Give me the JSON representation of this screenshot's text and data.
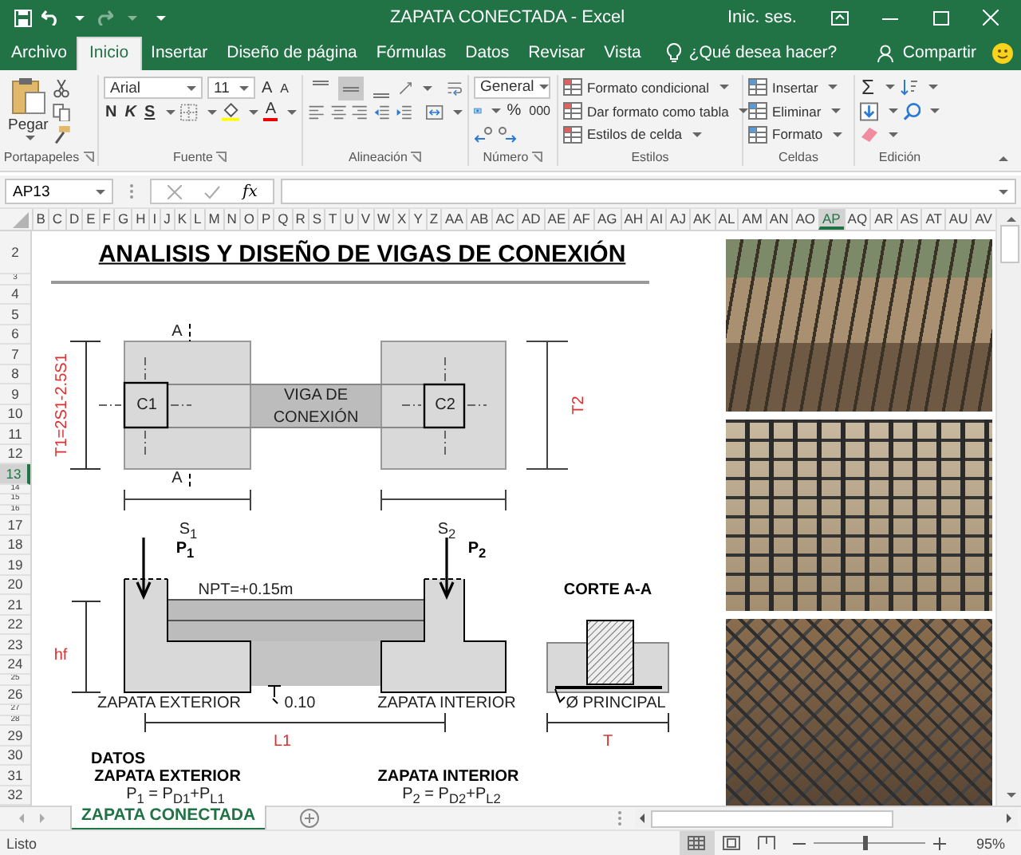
{
  "title_bar": {
    "title": "ZAPATA CONECTADA  -  Excel",
    "sign_in": "Inic. ses.",
    "redo_disabled": true
  },
  "ribbon_tabs": [
    {
      "label": "Archivo",
      "selected": false
    },
    {
      "label": "Inicio",
      "selected": true
    },
    {
      "label": "Insertar",
      "selected": false
    },
    {
      "label": "Diseño de página",
      "selected": false
    },
    {
      "label": "Fórmulas",
      "selected": false
    },
    {
      "label": "Datos",
      "selected": false
    },
    {
      "label": "Revisar",
      "selected": false
    },
    {
      "label": "Vista",
      "selected": false
    }
  ],
  "tell_me": {
    "placeholder": "¿Qué desea hacer?"
  },
  "share": "Compartir",
  "ribbon_groups": [
    {
      "kind": "clipboard",
      "label": "Portapapeles",
      "paste": "Pegar"
    },
    {
      "kind": "font",
      "label": "Fuente",
      "font": "Arial",
      "size": "11",
      "grow": "A",
      "shrink": "A",
      "bold": "N",
      "italic": "K",
      "underline": "S",
      "font_color": "A"
    },
    {
      "kind": "alignment",
      "label": "Alineación",
      "buttons": [
        {
          "kind": "top",
          "selected": false
        },
        {
          "kind": "middle",
          "selected": true
        },
        {
          "kind": "bottom",
          "selected": false
        }
      ]
    },
    {
      "kind": "number",
      "label": "Número",
      "format": "General",
      "percent": "%",
      "thousands": "000"
    },
    {
      "kind": "styles",
      "label": "Estilos",
      "items": [
        "Formato condicional",
        "Dar formato como tabla",
        "Estilos de celda"
      ]
    },
    {
      "kind": "cells",
      "label": "Celdas",
      "items": [
        "Insertar",
        "Eliminar",
        "Formato"
      ]
    },
    {
      "kind": "editing",
      "label": "Edición",
      "sum": "Σ"
    }
  ],
  "formula_bar": {
    "name_box": "AP13",
    "fx": "fx"
  },
  "columns": [
    {
      "label": "B",
      "selected": false
    },
    {
      "label": "C",
      "selected": false
    },
    {
      "label": "D",
      "selected": false
    },
    {
      "label": "E",
      "selected": false
    },
    {
      "label": "F",
      "selected": false
    },
    {
      "label": "G",
      "selected": false
    },
    {
      "label": "H",
      "selected": false
    },
    {
      "label": "I",
      "selected": false
    },
    {
      "label": "J",
      "selected": false
    },
    {
      "label": "K",
      "selected": false
    },
    {
      "label": "L",
      "selected": false
    },
    {
      "label": "M",
      "selected": false
    },
    {
      "label": "N",
      "selected": false
    },
    {
      "label": "O",
      "selected": false
    },
    {
      "label": "P",
      "selected": false
    },
    {
      "label": "Q",
      "selected": false
    },
    {
      "label": "R",
      "selected": false
    },
    {
      "label": "S",
      "selected": false
    },
    {
      "label": "T",
      "selected": false
    },
    {
      "label": "U",
      "selected": false
    },
    {
      "label": "V",
      "selected": false
    },
    {
      "label": "W",
      "selected": false
    },
    {
      "label": "X",
      "selected": false
    },
    {
      "label": "Y",
      "selected": false
    },
    {
      "label": "Z",
      "selected": false
    },
    {
      "label": "AA",
      "selected": false
    },
    {
      "label": "AB",
      "selected": false
    },
    {
      "label": "AC",
      "selected": false
    },
    {
      "label": "AD",
      "selected": false
    },
    {
      "label": "AE",
      "selected": false
    },
    {
      "label": "AF",
      "selected": false
    },
    {
      "label": "AG",
      "selected": false
    },
    {
      "label": "AH",
      "selected": false
    },
    {
      "label": "AI",
      "selected": false
    },
    {
      "label": "AJ",
      "selected": false
    },
    {
      "label": "AK",
      "selected": false
    },
    {
      "label": "AL",
      "selected": false
    },
    {
      "label": "AM",
      "selected": false
    },
    {
      "label": "AN",
      "selected": false
    },
    {
      "label": "AO",
      "selected": false
    },
    {
      "label": "AP",
      "selected": true
    },
    {
      "label": "AQ",
      "selected": false
    },
    {
      "label": "AR",
      "selected": false
    },
    {
      "label": "AS",
      "selected": false
    },
    {
      "label": "AT",
      "selected": false
    },
    {
      "label": "AU",
      "selected": false
    },
    {
      "label": "AV",
      "selected": false
    }
  ],
  "rows": [
    {
      "label": "2",
      "kind": "tall",
      "selected": false
    },
    {
      "label": "3",
      "kind": "thin",
      "selected": false
    },
    {
      "label": "4",
      "kind": "normal",
      "selected": false
    },
    {
      "label": "5",
      "kind": "normal",
      "selected": false
    },
    {
      "label": "6",
      "kind": "normal",
      "selected": false
    },
    {
      "label": "7",
      "kind": "normal",
      "selected": false
    },
    {
      "label": "8",
      "kind": "normal",
      "selected": false
    },
    {
      "label": "9",
      "kind": "normal",
      "selected": false
    },
    {
      "label": "10",
      "kind": "normal",
      "selected": false
    },
    {
      "label": "11",
      "kind": "normal",
      "selected": false
    },
    {
      "label": "12",
      "kind": "normal",
      "selected": false
    },
    {
      "label": "13",
      "kind": "normal",
      "selected": true
    },
    {
      "label": "14",
      "kind": "thin",
      "selected": false
    },
    {
      "label": "15",
      "kind": "thin",
      "selected": false
    },
    {
      "label": "16",
      "kind": "thin",
      "selected": false
    },
    {
      "label": "17",
      "kind": "normal",
      "selected": false
    },
    {
      "label": "18",
      "kind": "normal",
      "selected": false
    },
    {
      "label": "19",
      "kind": "normal",
      "selected": false
    },
    {
      "label": "20",
      "kind": "normal",
      "selected": false
    },
    {
      "label": "21",
      "kind": "normal",
      "selected": false
    },
    {
      "label": "22",
      "kind": "normal",
      "selected": false
    },
    {
      "label": "23",
      "kind": "normal",
      "selected": false
    },
    {
      "label": "24",
      "kind": "normal",
      "selected": false
    },
    {
      "label": "25",
      "kind": "thin",
      "selected": false
    },
    {
      "label": "26",
      "kind": "normal",
      "selected": false
    },
    {
      "label": "27",
      "kind": "thin",
      "selected": false
    },
    {
      "label": "28",
      "kind": "thin",
      "selected": false
    },
    {
      "label": "29",
      "kind": "normal",
      "selected": false
    },
    {
      "label": "30",
      "kind": "normal",
      "selected": false
    },
    {
      "label": "31",
      "kind": "normal",
      "selected": false
    },
    {
      "label": "32",
      "kind": "normal",
      "selected": false
    }
  ],
  "drawing": {
    "labels": [
      {
        "text": "ANALISIS Y DISEÑO DE VIGAS DE CONEXIÓN",
        "kind": "title"
      },
      {
        "text": "A",
        "kind": "plain"
      },
      {
        "text": "A",
        "kind": "plain"
      },
      {
        "text": "C1",
        "kind": "plain"
      },
      {
        "text": "VIGA DE",
        "kind": "plain"
      },
      {
        "text": "CONEXIÓN",
        "kind": "plain"
      },
      {
        "text": "C2",
        "kind": "plain"
      },
      {
        "text": "T1=2S1-2.5S1",
        "kind": "red-vertical"
      },
      {
        "text": "T2",
        "kind": "red-vertical"
      },
      {
        "text": "S$_{1}$",
        "kind": "plain"
      },
      {
        "text": "S$_{2}$",
        "kind": "plain"
      },
      {
        "text": "P$_{1}$",
        "kind": "bold"
      },
      {
        "text": "P$_{2}$",
        "kind": "bold"
      },
      {
        "text": "NPT=+0.15m",
        "kind": "plain"
      },
      {
        "text": "CORTE A-A",
        "kind": "bold"
      },
      {
        "text": "hf",
        "kind": "red"
      },
      {
        "text": "ZAPATA EXTERIOR",
        "kind": "plain"
      },
      {
        "text": "0.10",
        "kind": "plain"
      },
      {
        "text": "ZAPATA INTERIOR",
        "kind": "plain"
      },
      {
        "text": "Ø PRINCIPAL",
        "kind": "plain"
      },
      {
        "text": "L1",
        "kind": "red"
      },
      {
        "text": "T",
        "kind": "red"
      },
      {
        "text": "DATOS",
        "kind": "bold"
      },
      {
        "text": "ZAPATA EXTERIOR",
        "kind": "bold"
      },
      {
        "text": "ZAPATA INTERIOR",
        "kind": "bold"
      },
      {
        "text": "P$_{1}$ =   P$_{D1}$+P$_{L1}$",
        "kind": "plain"
      },
      {
        "text": "P$_{2}$ =   P$_{D2}$+P$_{L2}$",
        "kind": "plain"
      }
    ]
  },
  "sheet_tabs": [
    {
      "label": "ZAPATA CONECTADA",
      "selected": true
    }
  ],
  "status_bar": {
    "status": "Listo",
    "views": [
      {
        "kind": "normal",
        "selected": true
      },
      {
        "kind": "page_layout",
        "selected": false
      },
      {
        "kind": "page_break",
        "selected": false
      }
    ],
    "zoom": {
      "level": 0.46,
      "reading": "95%"
    }
  }
}
